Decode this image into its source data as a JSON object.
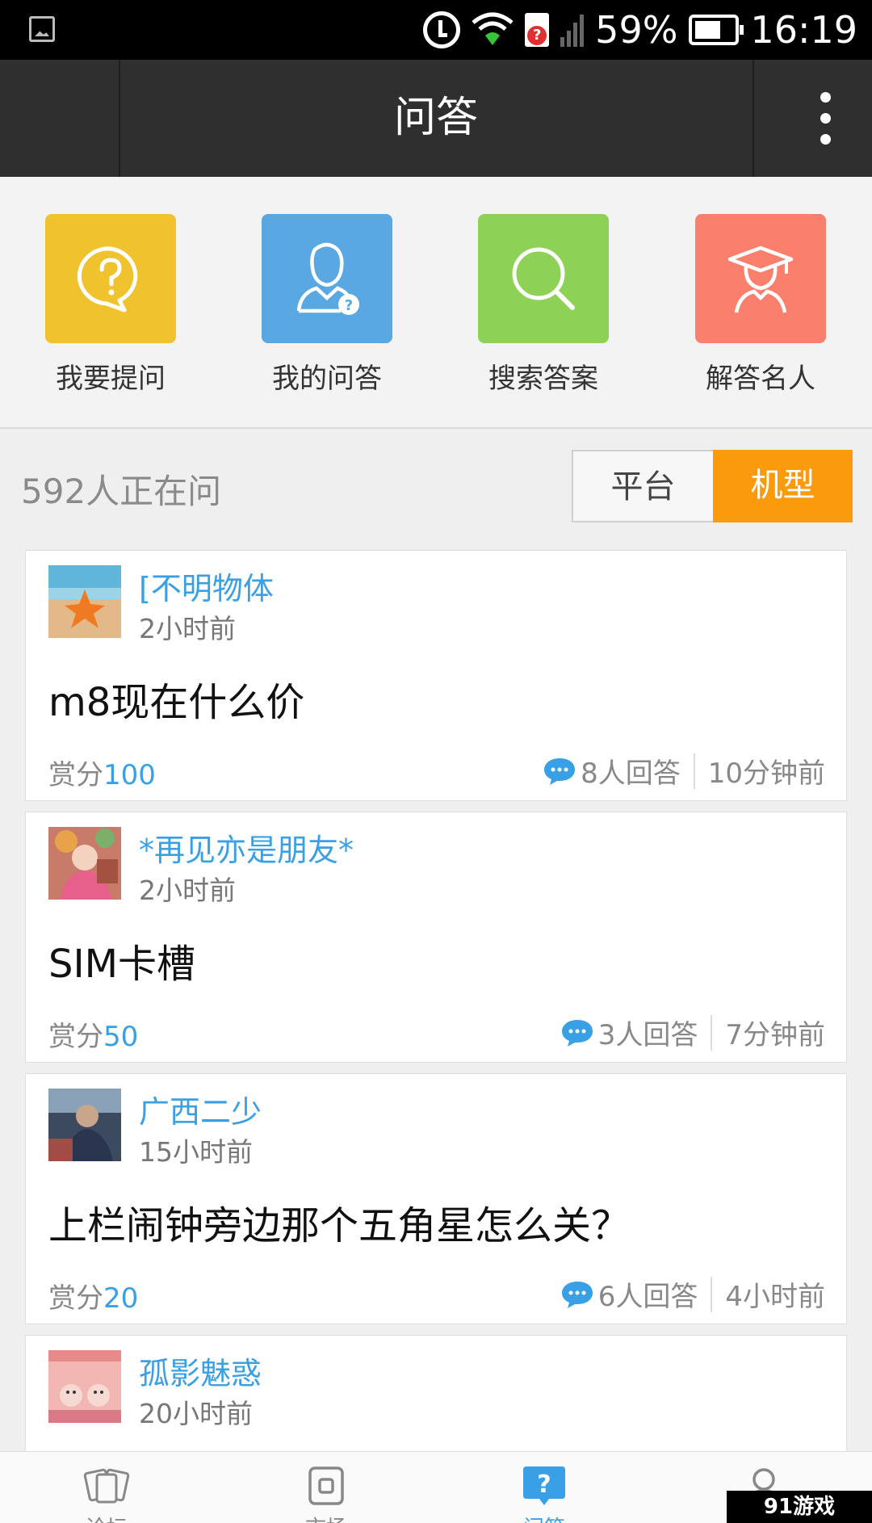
{
  "status_bar": {
    "battery": "59%",
    "time": "16:19"
  },
  "header": {
    "title": "问答"
  },
  "quick_actions": [
    {
      "label": "我要提问",
      "icon": "question-bubble-icon",
      "color": "#f0c22e"
    },
    {
      "label": "我的问答",
      "icon": "user-question-icon",
      "color": "#5aa8e2"
    },
    {
      "label": "搜索答案",
      "icon": "search-icon",
      "color": "#8dd157"
    },
    {
      "label": "解答名人",
      "icon": "graduate-icon",
      "color": "#fa7f6c"
    }
  ],
  "asking": {
    "count_text": "592人正在问"
  },
  "segments": {
    "platform": "平台",
    "model": "机型",
    "active": "机型",
    "active_color": "#fb9a0b"
  },
  "questions": [
    {
      "user": "[不明物体",
      "posted": "2小时前",
      "title": "m8现在什么价",
      "reward_label": "赏分",
      "reward_value": "100",
      "answers": "8人回答",
      "last_answer": "10分钟前"
    },
    {
      "user": "*再见亦是朋友*",
      "posted": "2小时前",
      "title": "SIM卡槽",
      "reward_label": "赏分",
      "reward_value": "50",
      "answers": "3人回答",
      "last_answer": "7分钟前"
    },
    {
      "user": "广西二少",
      "posted": "15小时前",
      "title": "上栏闹钟旁边那个五角星怎么关？",
      "reward_label": "赏分",
      "reward_value": "20",
      "answers": "6人回答",
      "last_answer": "4小时前"
    },
    {
      "user": "孤影魅惑",
      "posted": "20小时前"
    }
  ],
  "bottom_nav": {
    "forum": "论坛",
    "market": "市场",
    "qa": "问答",
    "badge": "91游戏"
  },
  "colors": {
    "accent_blue": "#3aa0e6",
    "titlebar": "#2f2f2f"
  }
}
